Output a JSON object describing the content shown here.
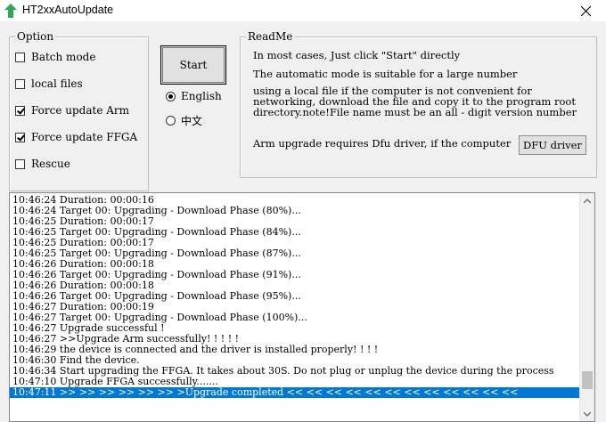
{
  "window": {
    "title": "HT2xxAutoUpdate"
  },
  "option": {
    "legend": "Option",
    "items": [
      {
        "label": "Batch mode",
        "checked": false
      },
      {
        "label": "local files",
        "checked": false
      },
      {
        "label": "Force update Arm",
        "checked": true
      },
      {
        "label": "Force update FFGA",
        "checked": true
      },
      {
        "label": "Rescue",
        "checked": false
      }
    ]
  },
  "start_label": "Start",
  "language": {
    "options": [
      {
        "label": "English",
        "selected": true
      },
      {
        "label": "中文",
        "selected": false
      }
    ]
  },
  "readme": {
    "legend": "ReadMe",
    "line1": "In most cases, Just click \"Start\" directly",
    "line2": "The automatic mode is suitable for a large number",
    "line3": "using a local file if the computer is not convenient for",
    "line4": "networking, download the file and copy it to the program root",
    "line5": "directory.note!File name must be an all - digit version number",
    "line6": "Arm upgrade requires Dfu driver, if the computer",
    "dfu_button": "DFU driver"
  },
  "log": {
    "lines": [
      "10:46:24  Duration: 00:00:16",
      "10:46:24  Target 00: Upgrading - Download Phase (80%)...",
      "10:46:25  Duration: 00:00:17",
      "10:46:25  Target 00: Upgrading - Download Phase (84%)...",
      "10:46:25  Duration: 00:00:17",
      "10:46:25  Target 00: Upgrading - Download Phase (87%)...",
      "10:46:26  Duration: 00:00:18",
      "10:46:26  Target 00: Upgrading - Download Phase (91%)...",
      "10:46:26  Duration: 00:00:18",
      "10:46:26  Target 00: Upgrading - Download Phase (95%)...",
      "10:46:27  Duration: 00:00:19",
      "10:46:27  Target 00: Upgrading - Download Phase (100%)...",
      "10:46:27  Upgrade successful !",
      "10:46:27  >>Upgrade Arm successfully! ! ! ! !",
      "10:46:29  the device is connected and the driver is installed properly! ! ! !",
      "10:46:30  Find the device.",
      "10:46:34  Start upgrading the FFGA. It takes about 30S. Do not plug or unplug the device during the process",
      "10:47:10  Upgrade FFGA successfully.......",
      "10:47:11  >> >> >> >> >> >> >Upgrade completed << << << << << << << << << << << <<"
    ]
  }
}
